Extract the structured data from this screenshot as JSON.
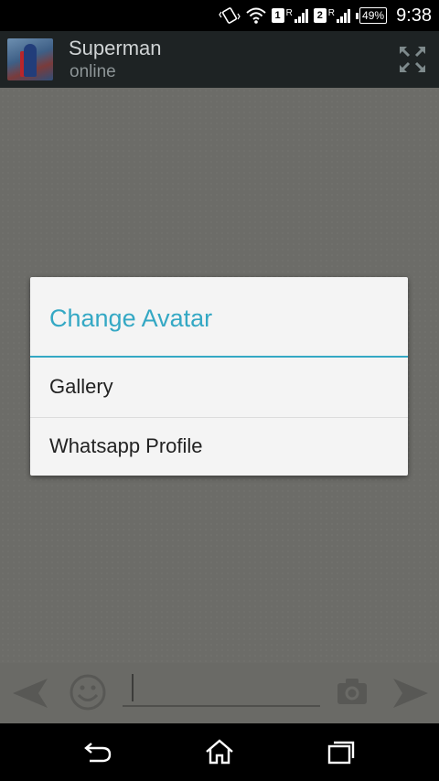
{
  "status_bar": {
    "sim1": "1",
    "sim2": "2",
    "roaming": "R",
    "battery": "49%",
    "time": "9:38",
    "icons": [
      "vibrate-icon",
      "wifi-icon",
      "signal-icon",
      "battery-icon"
    ]
  },
  "action_bar": {
    "name": "Superman",
    "status": "online",
    "icons": [
      "avatar",
      "expand-icon"
    ]
  },
  "dialog": {
    "title": "Change Avatar",
    "items": [
      {
        "label": "Gallery"
      },
      {
        "label": "Whatsapp Profile"
      }
    ],
    "accent_color": "#34a8c4"
  },
  "input_bar": {
    "icons": [
      "back-arrow-icon",
      "emoji-icon",
      "camera-icon",
      "send-icon"
    ]
  },
  "nav_bar": {
    "icons": [
      "back-icon",
      "home-icon",
      "recent-apps-icon"
    ]
  }
}
